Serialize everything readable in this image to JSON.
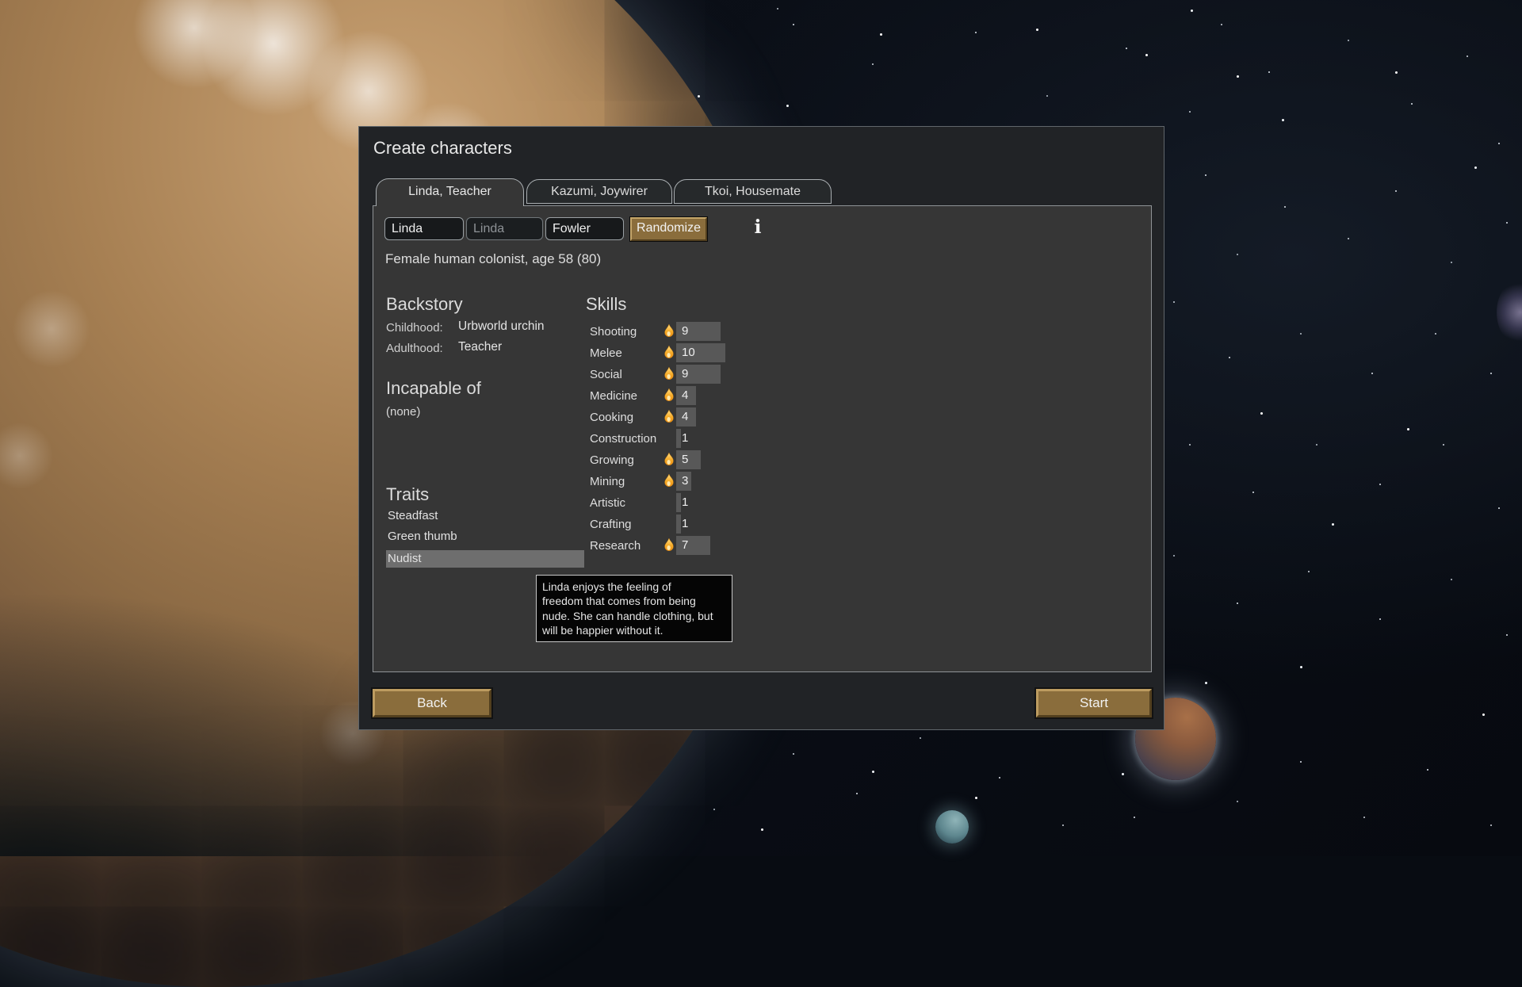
{
  "window": {
    "title": "Create characters"
  },
  "tabs": [
    {
      "label": "Linda, Teacher",
      "active": true
    },
    {
      "label": "Kazumi, Joywirer",
      "active": false
    },
    {
      "label": "Tkoi, Housemate",
      "active": false
    }
  ],
  "form": {
    "first_name": "Linda",
    "nickname": "Linda",
    "last_name": "Fowler",
    "randomize_label": "Randomize"
  },
  "icons": {
    "info": "i"
  },
  "summary": "Female human colonist, age 58 (80)",
  "backstory": {
    "heading": "Backstory",
    "childhood_label": "Childhood:",
    "childhood": "Urbworld urchin",
    "adulthood_label": "Adulthood:",
    "adulthood": "Teacher"
  },
  "incapable": {
    "heading": "Incapable of",
    "value": "(none)"
  },
  "traits": {
    "heading": "Traits",
    "items": [
      "Steadfast",
      "Green thumb",
      "Nudist"
    ],
    "highlighted": "Nudist"
  },
  "skills": {
    "heading": "Skills",
    "max_level": 20,
    "items": [
      {
        "name": "Shooting",
        "level": 9,
        "passion": true
      },
      {
        "name": "Melee",
        "level": 10,
        "passion": true
      },
      {
        "name": "Social",
        "level": 9,
        "passion": true
      },
      {
        "name": "Medicine",
        "level": 4,
        "passion": true
      },
      {
        "name": "Cooking",
        "level": 4,
        "passion": true
      },
      {
        "name": "Construction",
        "level": 1,
        "passion": false
      },
      {
        "name": "Growing",
        "level": 5,
        "passion": true
      },
      {
        "name": "Mining",
        "level": 3,
        "passion": true
      },
      {
        "name": "Artistic",
        "level": 1,
        "passion": false
      },
      {
        "name": "Crafting",
        "level": 1,
        "passion": false
      },
      {
        "name": "Research",
        "level": 7,
        "passion": true
      }
    ]
  },
  "tooltip": {
    "text": "Linda enjoys the feeling of\nfreedom that comes from being\nnude. She can handle clothing, but\nwill be happier without it."
  },
  "footer": {
    "back_label": "Back",
    "start_label": "Start"
  },
  "colors": {
    "dialog_bg": "#212326",
    "panel_bg": "#363636",
    "button_tan": "#8a6d3c",
    "skill_bar_fill": "#585858",
    "trait_highlight": "#6e6e6e",
    "passion_flame": "#f2990f",
    "tooltip_bg": "#050505"
  }
}
